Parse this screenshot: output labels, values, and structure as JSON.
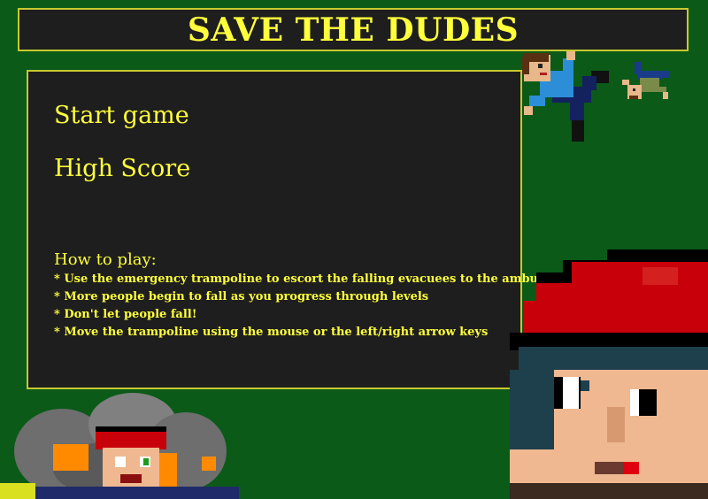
{
  "title": "SAVE THE DUDES",
  "menu": {
    "start_game": "Start game",
    "high_score": "High Score"
  },
  "how_to_play": {
    "heading": "How to play:",
    "items": [
      "* Use the emergency trampoline to escort the falling evacuees to the ambulence",
      "* More people begin to fall as you progress through levels",
      "* Don't let people fall!",
      "* Move the trampoline using the mouse or the left/right arrow keys"
    ]
  },
  "colors": {
    "background": "#0b5a18",
    "panel": "#1e1e1e",
    "border": "#c8c832",
    "text": "#ffff3c"
  },
  "decorations": {
    "falling_dude_icon": "falling-dude-icon",
    "small_falling_dude_icon": "small-falling-dude-icon",
    "firefighter_face_icon": "firefighter-face-icon",
    "burning_dude_icon": "burning-dude-icon"
  }
}
